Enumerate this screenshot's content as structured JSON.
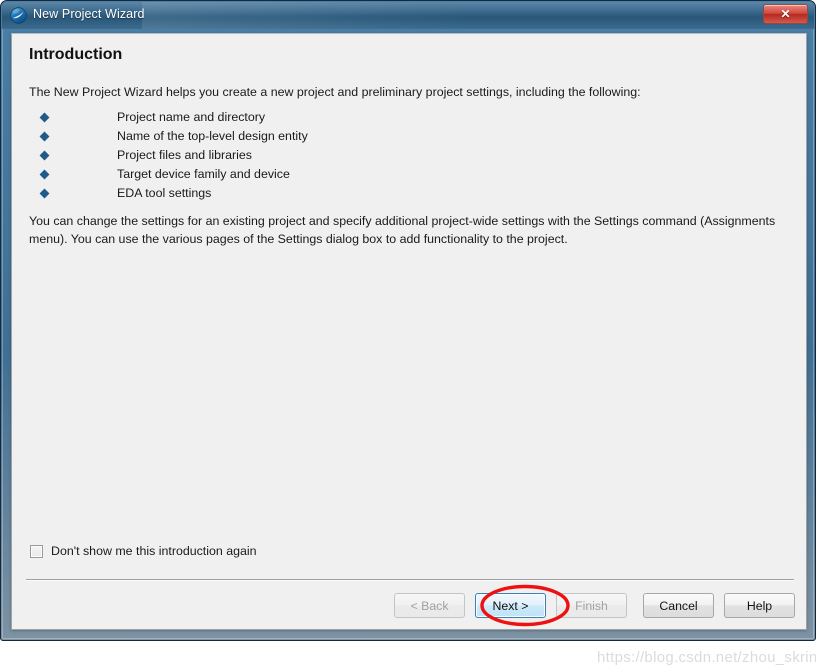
{
  "window": {
    "title": "New Project Wizard",
    "app_icon": "quartus-sphere-icon",
    "close_label": "✕"
  },
  "content": {
    "heading": "Introduction",
    "intro_paragraph": "The New Project Wizard helps you create a new project and preliminary project settings, including the following:",
    "bullets": [
      "Project name and directory",
      "Name of the top-level design entity",
      "Project files and libraries",
      "Target device family and device",
      "EDA tool settings"
    ],
    "body_paragraph": "You can change the settings for an existing project and specify additional project-wide settings with the Settings command (Assignments menu). You can use the various pages of the Settings dialog box to add functionality to the project."
  },
  "checkbox": {
    "label": "Don't show me this introduction again",
    "checked": false
  },
  "buttons": [
    {
      "id": "back",
      "label": "< Back",
      "state": "disabled"
    },
    {
      "id": "next",
      "label": "Next >",
      "state": "focused"
    },
    {
      "id": "finish",
      "label": "Finish",
      "state": "disabled"
    },
    {
      "id": "cancel",
      "label": "Cancel",
      "state": "normal"
    },
    {
      "id": "help",
      "label": "Help",
      "state": "normal"
    }
  ],
  "annotation": {
    "shape": "ellipse",
    "color": "#ee1111",
    "target": "next-button"
  },
  "watermark": {
    "text": "https://blog.csdn.net/zhou_skring"
  },
  "colors": {
    "titlebar": "#2d5c80",
    "frame": "#406f94",
    "panel": "#f0f0f0",
    "bullet": "#1f5c8b",
    "focus_border": "#3c7fb1",
    "close_button": "#d2483c",
    "annotation": "#ee1111"
  }
}
